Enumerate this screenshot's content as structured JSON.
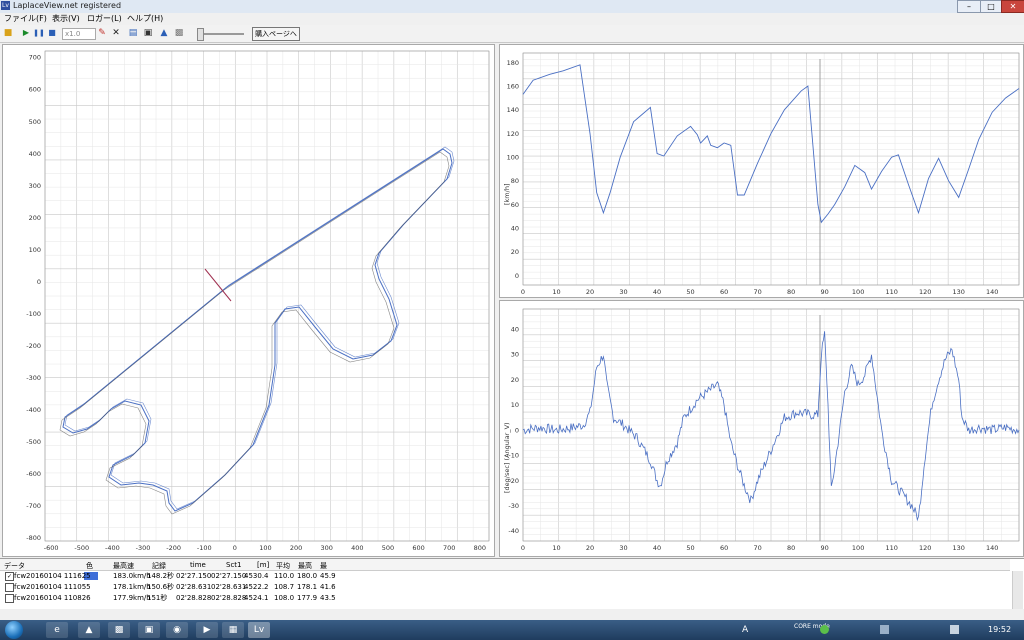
{
  "window": {
    "title": "LaplaceView.net registered",
    "app_icon_label": "Lv",
    "minimize_icon": "minimize-icon",
    "maximize_icon": "maximize-icon",
    "close_icon": "close-icon"
  },
  "menu": [
    {
      "label": "ファイル(F)"
    },
    {
      "label": "表示(V)"
    },
    {
      "label": "ロガー(L)"
    },
    {
      "label": "ヘルプ(H)"
    }
  ],
  "toolbar": {
    "speed": "x1.0",
    "buy_label": "購入ページへ",
    "accent_play": "#1a8a2a",
    "accent_stop": "#2b5fb6"
  },
  "track_map": {
    "x_ticks": [
      "-600",
      "-500",
      "-400",
      "-300",
      "-200",
      "-100",
      "0",
      "100",
      "200",
      "300",
      "400",
      "500",
      "600",
      "700",
      "800"
    ],
    "y_ticks": [
      "700",
      "600",
      "500",
      "400",
      "300",
      "200",
      "100",
      "0",
      "-100",
      "-200",
      "-300",
      "-400",
      "-500",
      "-600",
      "-700",
      "-800"
    ],
    "line_color": "#4a6fc3"
  },
  "speed_chart": {
    "ylabel": "[km/h]",
    "x_ticks": [
      "0",
      "10",
      "20",
      "30",
      "40",
      "50",
      "60",
      "70",
      "80",
      "90",
      "100",
      "110",
      "120",
      "130",
      "140"
    ],
    "y_ticks": [
      "180",
      "160",
      "140",
      "120",
      "100",
      "80",
      "60",
      "40",
      "20",
      "0"
    ]
  },
  "angular_chart": {
    "ylabel": "[deg/sec] (Angular_V)",
    "x_ticks": [
      "0",
      "10",
      "20",
      "30",
      "40",
      "50",
      "60",
      "70",
      "80",
      "90",
      "100",
      "110",
      "120",
      "130",
      "140"
    ],
    "y_ticks": [
      "40",
      "30",
      "20",
      "10",
      "0",
      "-10",
      "-20",
      "-30",
      "-40"
    ]
  },
  "chart_data": [
    {
      "type": "line",
      "title": "",
      "xlabel": "",
      "ylabel": "[km/h]",
      "xlim": [
        0,
        148
      ],
      "ylim": [
        -8,
        188
      ],
      "color": "#4a6fc3",
      "series": [
        {
          "x": [
            0,
            3,
            8,
            12,
            17,
            20,
            22,
            24,
            26,
            29,
            33,
            38,
            40,
            42,
            46,
            50,
            52,
            53,
            55,
            56,
            58,
            60,
            62,
            64,
            66,
            70,
            74,
            78,
            83,
            85,
            88,
            89,
            91,
            93,
            96,
            99,
            102,
            104,
            107,
            110,
            112,
            115,
            118,
            121,
            124,
            127,
            130,
            133,
            136,
            140,
            144,
            148
          ],
          "y": [
            153,
            165,
            170,
            173,
            178,
            120,
            70,
            53,
            70,
            100,
            130,
            142,
            103,
            101,
            118,
            126,
            119,
            112,
            118,
            110,
            108,
            112,
            110,
            68,
            68,
            95,
            120,
            140,
            156,
            160,
            60,
            45,
            52,
            60,
            75,
            93,
            87,
            73,
            88,
            100,
            102,
            77,
            53,
            82,
            99,
            80,
            66,
            90,
            115,
            138,
            150,
            158
          ]
        }
      ]
    },
    {
      "type": "line",
      "title": "",
      "xlabel": "",
      "ylabel": "[deg/sec] (Angular_V)",
      "xlim": [
        0,
        148
      ],
      "ylim": [
        -44,
        48
      ],
      "color": "#4a6fc3",
      "series": [
        {
          "x": [
            0,
            5,
            10,
            15,
            18,
            20,
            22,
            24,
            25,
            27,
            30,
            34,
            38,
            40,
            41,
            43,
            46,
            48,
            52,
            55,
            58,
            60,
            62,
            64,
            66,
            68,
            70,
            74,
            78,
            82,
            86,
            88,
            89,
            90,
            91,
            92,
            94,
            96,
            98,
            100,
            102,
            104,
            105,
            107,
            110,
            113,
            116,
            118,
            120,
            122,
            124,
            126,
            128,
            130,
            131,
            133,
            136,
            140,
            144,
            148
          ],
          "y": [
            0,
            1,
            0,
            1,
            2,
            7,
            25,
            30,
            18,
            5,
            2,
            -3,
            -12,
            -20,
            -22,
            -12,
            -5,
            5,
            12,
            15,
            18,
            10,
            -5,
            -14,
            -22,
            -28,
            -20,
            -8,
            5,
            7,
            6,
            6,
            30,
            38,
            10,
            -24,
            -5,
            15,
            25,
            18,
            22,
            30,
            20,
            0,
            -20,
            -25,
            -30,
            -35,
            -10,
            10,
            20,
            28,
            32,
            20,
            5,
            0,
            1,
            0,
            1,
            0
          ]
        }
      ]
    }
  ],
  "data_list": {
    "headers": [
      "データ",
      "色",
      "最高速",
      "記録",
      "time",
      "Sct1",
      "[m]",
      "平均",
      "最高",
      "最"
    ],
    "rows": [
      {
        "checked": true,
        "name": "fcw20160104 111625",
        "color": "#3f6fd8",
        "max_speed": "183.0km/h",
        "record": "148.2秒",
        "time": "02'27.150",
        "sct1": "02'27.150",
        "dist": "4530.4",
        "avg": "110.0",
        "max": "180.0",
        "last": "45.9"
      },
      {
        "checked": false,
        "name": "fcw20160104 111055",
        "color": "",
        "max_speed": "178.1km/h",
        "record": "150.6秒",
        "time": "02'28.631",
        "sct1": "02'28.631",
        "dist": "4522.2",
        "avg": "108.7",
        "max": "178.1",
        "last": "41.6"
      },
      {
        "checked": false,
        "name": "fcw20160104 110826",
        "color": "",
        "max_speed": "177.9km/h",
        "record": "151秒",
        "time": "02'28.828",
        "sct1": "02'28.828",
        "dist": "4524.1",
        "avg": "108.0",
        "max": "177.9",
        "last": "43.5"
      }
    ]
  },
  "taskbar": {
    "time": "19:52",
    "tray_label": "A",
    "tray_small": "CORE\nmode"
  }
}
